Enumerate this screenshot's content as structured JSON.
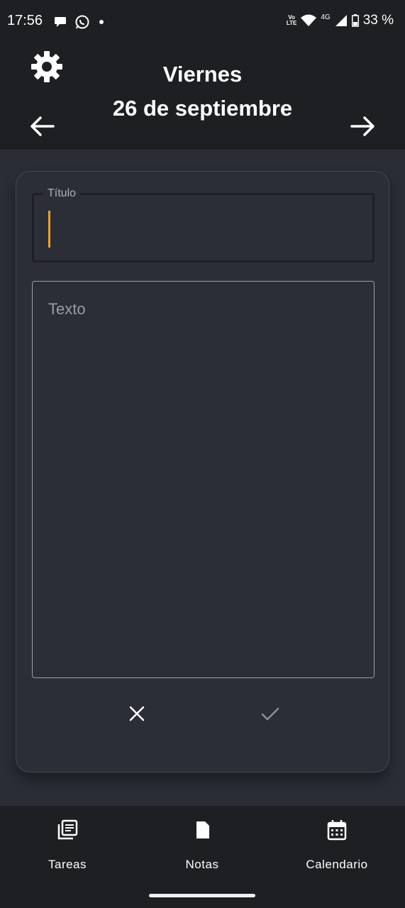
{
  "status_bar": {
    "time": "17:56",
    "volte_line1": "Vo",
    "volte_line2": "LTE",
    "network": "4G",
    "battery": "33 %"
  },
  "header": {
    "day": "Viernes",
    "date": "26 de septiembre",
    "settings_icon": "gear-icon",
    "prev_icon": "arrow-left-icon",
    "next_icon": "arrow-right-icon"
  },
  "note_form": {
    "title_label": "Título",
    "title_value": "",
    "text_placeholder": "Texto",
    "cancel_icon": "close-icon",
    "confirm_icon": "check-icon"
  },
  "bottom_nav": {
    "items": [
      {
        "label": "Tareas",
        "icon": "tasks-icon"
      },
      {
        "label": "Notas",
        "icon": "note-icon"
      },
      {
        "label": "Calendario",
        "icon": "calendar-icon"
      }
    ]
  },
  "colors": {
    "background": "#2a2d36",
    "header": "#1e1f23",
    "accent_cursor": "#e8a13a"
  }
}
